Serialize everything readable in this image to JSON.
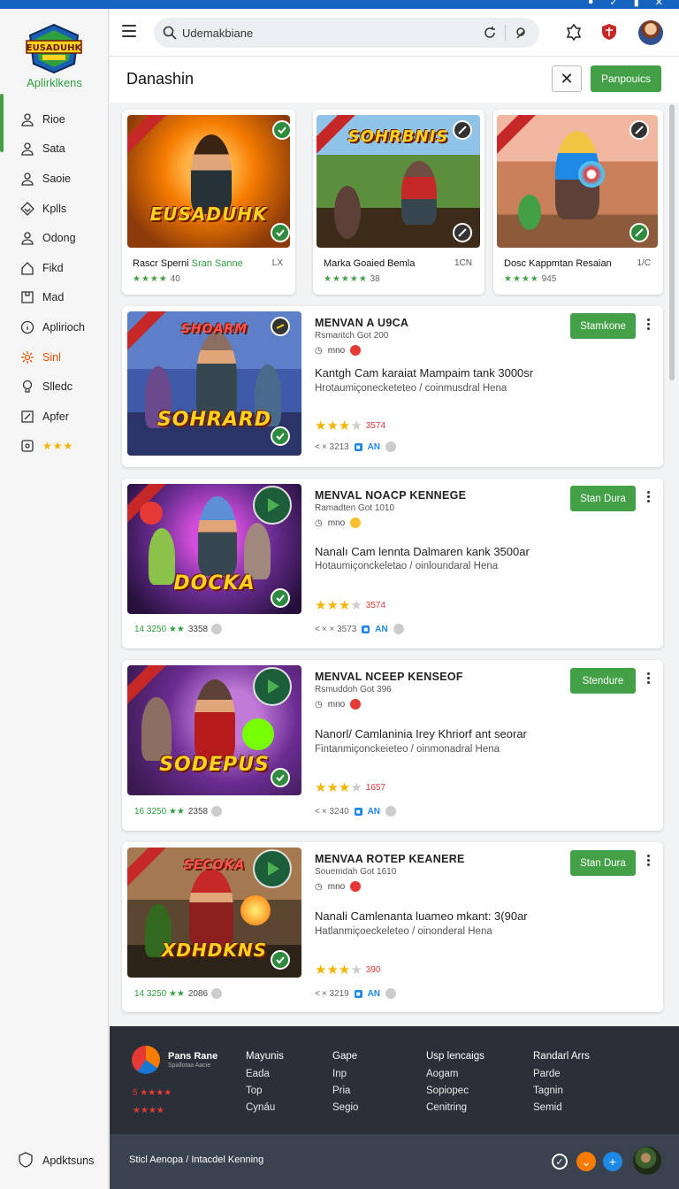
{
  "app": {
    "logo_text": "EUSADUHK",
    "brand": "Aplirklkens"
  },
  "sidebar": {
    "items": [
      {
        "label": "Rioe",
        "icon": "user-icon"
      },
      {
        "label": "Sata",
        "icon": "user-icon"
      },
      {
        "label": "Saoie",
        "icon": "user-icon"
      },
      {
        "label": "Kplls",
        "icon": "diamond-icon"
      },
      {
        "label": "Odong",
        "icon": "user-icon"
      },
      {
        "label": "Fikd",
        "icon": "home-icon"
      },
      {
        "label": "Mad",
        "icon": "box-icon"
      },
      {
        "label": "Aplirioch",
        "icon": "info-icon"
      },
      {
        "label": "Sinl",
        "icon": "gear-icon"
      },
      {
        "label": "Slledc",
        "icon": "bulb-icon"
      },
      {
        "label": "Apfer",
        "icon": "edit-icon"
      },
      {
        "label": "★★★",
        "icon": "star-box-icon"
      }
    ],
    "bottom_label": "Apdktsuns"
  },
  "header": {
    "search_value": "Udemakbiane"
  },
  "titlebar": {
    "title": "Danashin",
    "close_label": "✕",
    "action_label": "Panpouics"
  },
  "top_cards": [
    {
      "art_title": "EUSADUHK",
      "name": "Rascr Sperni",
      "name_tag": "Sran Sanne",
      "size": "LX",
      "rating_stars": "★★★★",
      "rating": "40"
    },
    {
      "art_title": "SOHRBNIS",
      "name": "Marka Goaied Bemla",
      "name_tag": "",
      "size": "1CN",
      "rating_stars": "★★★★★",
      "rating": "38"
    },
    {
      "art_title": "",
      "name": "Dosc Kappmtan Resaian",
      "name_tag": "",
      "size": "1/C",
      "rating_stars": "★★★★",
      "rating": "945"
    }
  ],
  "list_cards": [
    {
      "art_title": "SOHRARD",
      "title": "MENVAN A U9CA",
      "sub": "Rsmaritch Got 200",
      "meta": "mno",
      "desc": "Kantgh Cam karaiat Mampaim tank 3000sr",
      "desc2": "Hrotaumiçonecketeteo / coinmusdral Hena",
      "rating": "3574",
      "stats": "< × 3213",
      "an_label": "AN",
      "button": "Stamkone",
      "left_text": "",
      "left_num": ""
    },
    {
      "art_title": "DOCKA",
      "title": "MENVAL NOACP KENNEGE",
      "sub": "Ramadten Got 1010",
      "meta": "mno",
      "desc": "Nanalı Cam lennta Dalmaren kank 3500ar",
      "desc2": "Hotaumiçonckeletao / oinloundaral Hena",
      "rating": "3574",
      "stats": "< × × 3573",
      "an_label": "AN",
      "button": "Stan Dura",
      "left_text": "14 3250 ★★",
      "left_num": "3358"
    },
    {
      "art_title": "SODEPUS",
      "title": "MENVAL NCEEP KENSEOF",
      "sub": "Rsmuddoh Got 396",
      "meta": "mno",
      "desc": "Nanorl/ Camlaninia Irey Khriorf ant seorar",
      "desc2": "Fintanmiçonckeieteo / oinmonadral Hena",
      "rating": "1657",
      "stats": "< × 3240",
      "an_label": "AN",
      "button": "Stendure",
      "left_text": "16 3250 ★★",
      "left_num": "2358"
    },
    {
      "art_title": "XDHDKNS",
      "title": "MENVAA ROTEP KEANERE",
      "sub": "Souemdah Got 1610",
      "meta": "mno",
      "desc": "Nanali Camlenanta luameo mkant: 3(90ar",
      "desc2": "Hatlanmiçoeckeleteo / oinonderal Hena",
      "rating": "390",
      "stats": "< × 3219",
      "an_label": "AN",
      "button": "Stan Dura",
      "left_text": "14 3250 ★★",
      "left_num": "2086"
    }
  ],
  "footer": {
    "brand": "Pans Rane",
    "brand_sub": "Spallotaa Aacie",
    "rating_rows": [
      "5 ★★★★",
      "★★★★"
    ],
    "columns": [
      {
        "heading": "Mayunis",
        "items": [
          "Eada",
          "Top",
          "Cynáu"
        ]
      },
      {
        "heading": "Gape",
        "items": [
          "Inp",
          "Pria",
          "Segio"
        ]
      },
      {
        "heading": "Usp lencaigs",
        "items": [
          "Aogam",
          "Sopiopec",
          "Cenitring"
        ]
      },
      {
        "heading": "Randarl Arrs",
        "items": [
          "Parde",
          "Tagnin",
          "Semid"
        ]
      }
    ],
    "bottom_text": "Sticl Aenopa / Intacdel Kenning"
  },
  "colors": {
    "accent": "#43a047",
    "topbar": "#1565c0",
    "footer": "#2b3038"
  }
}
